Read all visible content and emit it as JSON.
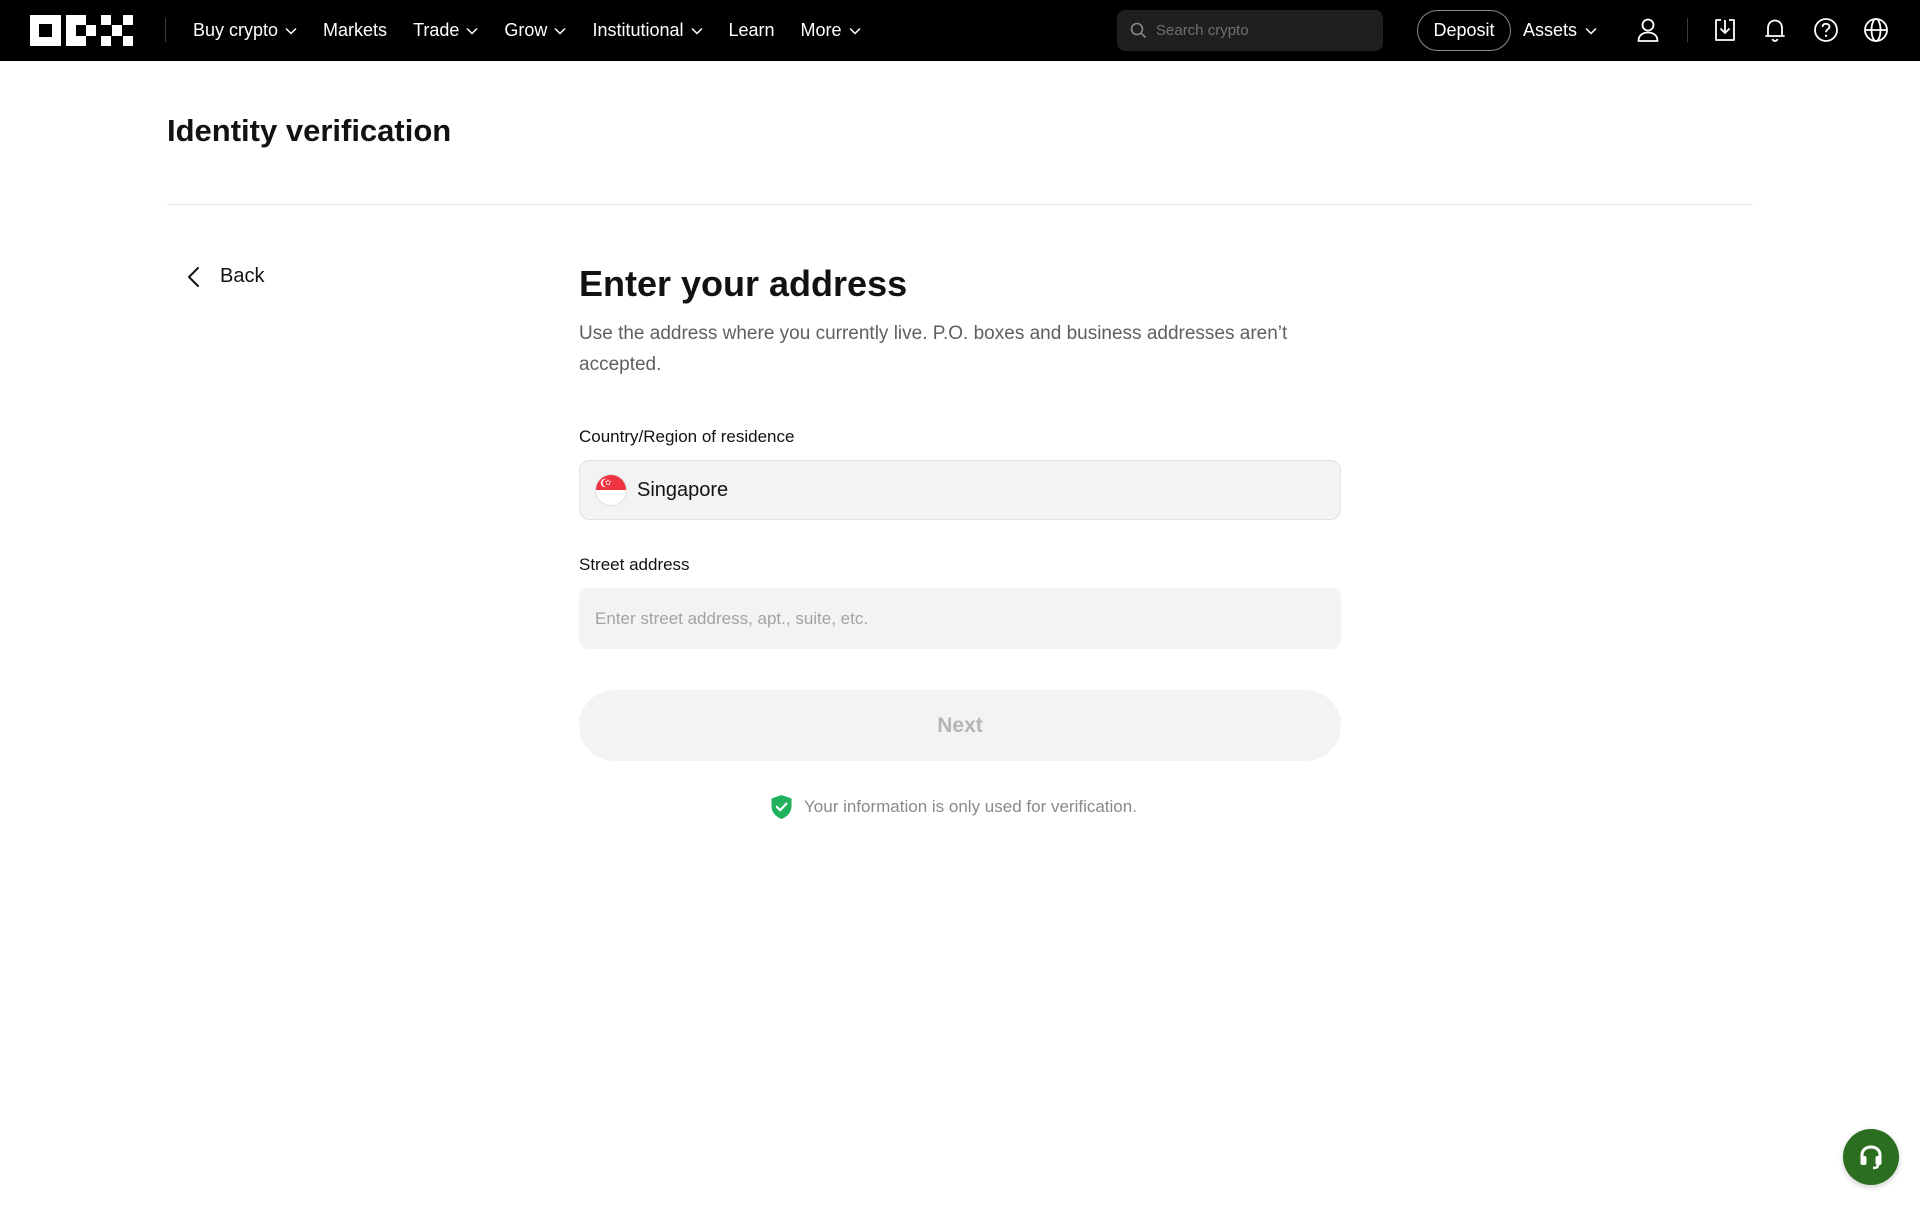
{
  "nav": {
    "items": [
      {
        "label": "Buy crypto",
        "dropdown": true
      },
      {
        "label": "Markets",
        "dropdown": false
      },
      {
        "label": "Trade",
        "dropdown": true
      },
      {
        "label": "Grow",
        "dropdown": true
      },
      {
        "label": "Institutional",
        "dropdown": true
      },
      {
        "label": "Learn",
        "dropdown": false
      },
      {
        "label": "More",
        "dropdown": true
      }
    ],
    "search_placeholder": "Search crypto",
    "deposit_label": "Deposit",
    "assets_label": "Assets",
    "icons": [
      "user-icon",
      "download-icon",
      "bell-icon",
      "help-icon",
      "globe-icon"
    ]
  },
  "page": {
    "title": "Identity verification",
    "back_label": "Back"
  },
  "form": {
    "title": "Enter your address",
    "subtitle": "Use the address where you currently live. P.O. boxes and business addresses aren’t accepted.",
    "country_label": "Country/Region of residence",
    "country_value": "Singapore",
    "street_label": "Street address",
    "street_placeholder": "Enter street address, apt., suite, etc.",
    "street_value": "",
    "next_label": "Next",
    "next_enabled": false,
    "privacy_note": "Your information is only used for verification."
  },
  "colors": {
    "nav_bg": "#000000",
    "accent_green": "#2c6e1f",
    "shield_green": "#21b15c",
    "flag_red": "#ef3340"
  }
}
